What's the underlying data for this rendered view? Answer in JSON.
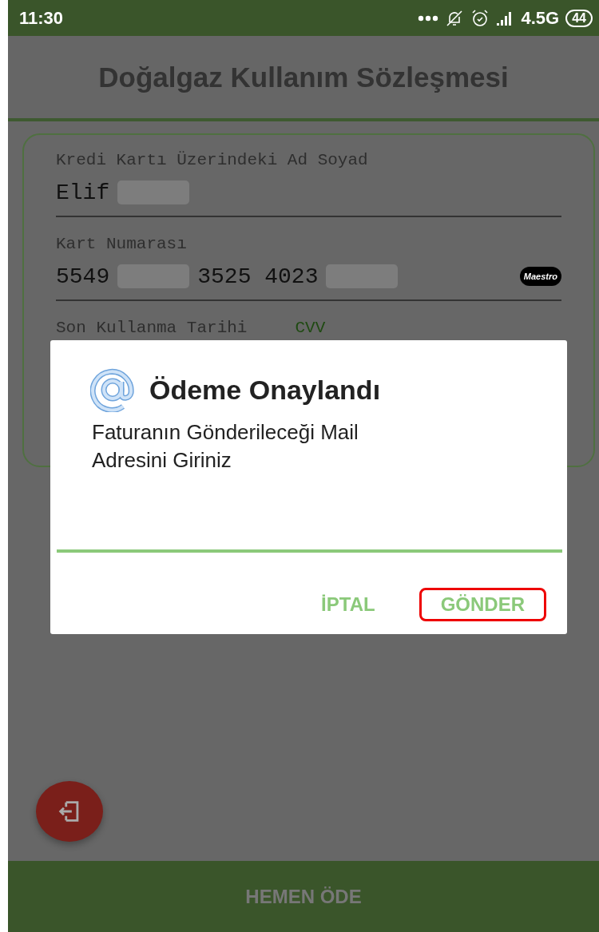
{
  "status_bar": {
    "time": "11:30",
    "network": "4.5G",
    "battery": "44"
  },
  "title": "Doğalgaz Kullanım Sözleşmesi",
  "fields": [
    {
      "label": "Kredi Kartı Üzerindeki Ad Soyad",
      "focused": false,
      "segments": [
        {
          "kind": "text",
          "text": "Elif"
        },
        {
          "kind": "redacted"
        }
      ]
    },
    {
      "label": "Kart Numarası",
      "focused": false,
      "card_logo": "Maestro",
      "segments": [
        {
          "kind": "text",
          "text": "5549"
        },
        {
          "kind": "redacted"
        },
        {
          "kind": "text",
          "text": "3525 4023"
        },
        {
          "kind": "redacted"
        }
      ]
    }
  ],
  "hidden_labels": [
    {
      "label": "Son Kullanma Tarihi",
      "focused": false
    },
    {
      "label": "CVV",
      "focused": true
    }
  ],
  "dialog": {
    "title": "Ödeme Onaylandı",
    "message": "Faturanın Gönderileceği Mail Adresini Giriniz",
    "buttons": [
      {
        "label": "İPTAL",
        "highlighted": false
      },
      {
        "label": "GÖNDER",
        "highlighted": true
      }
    ]
  },
  "pay_button": "HEMEN ÖDE"
}
